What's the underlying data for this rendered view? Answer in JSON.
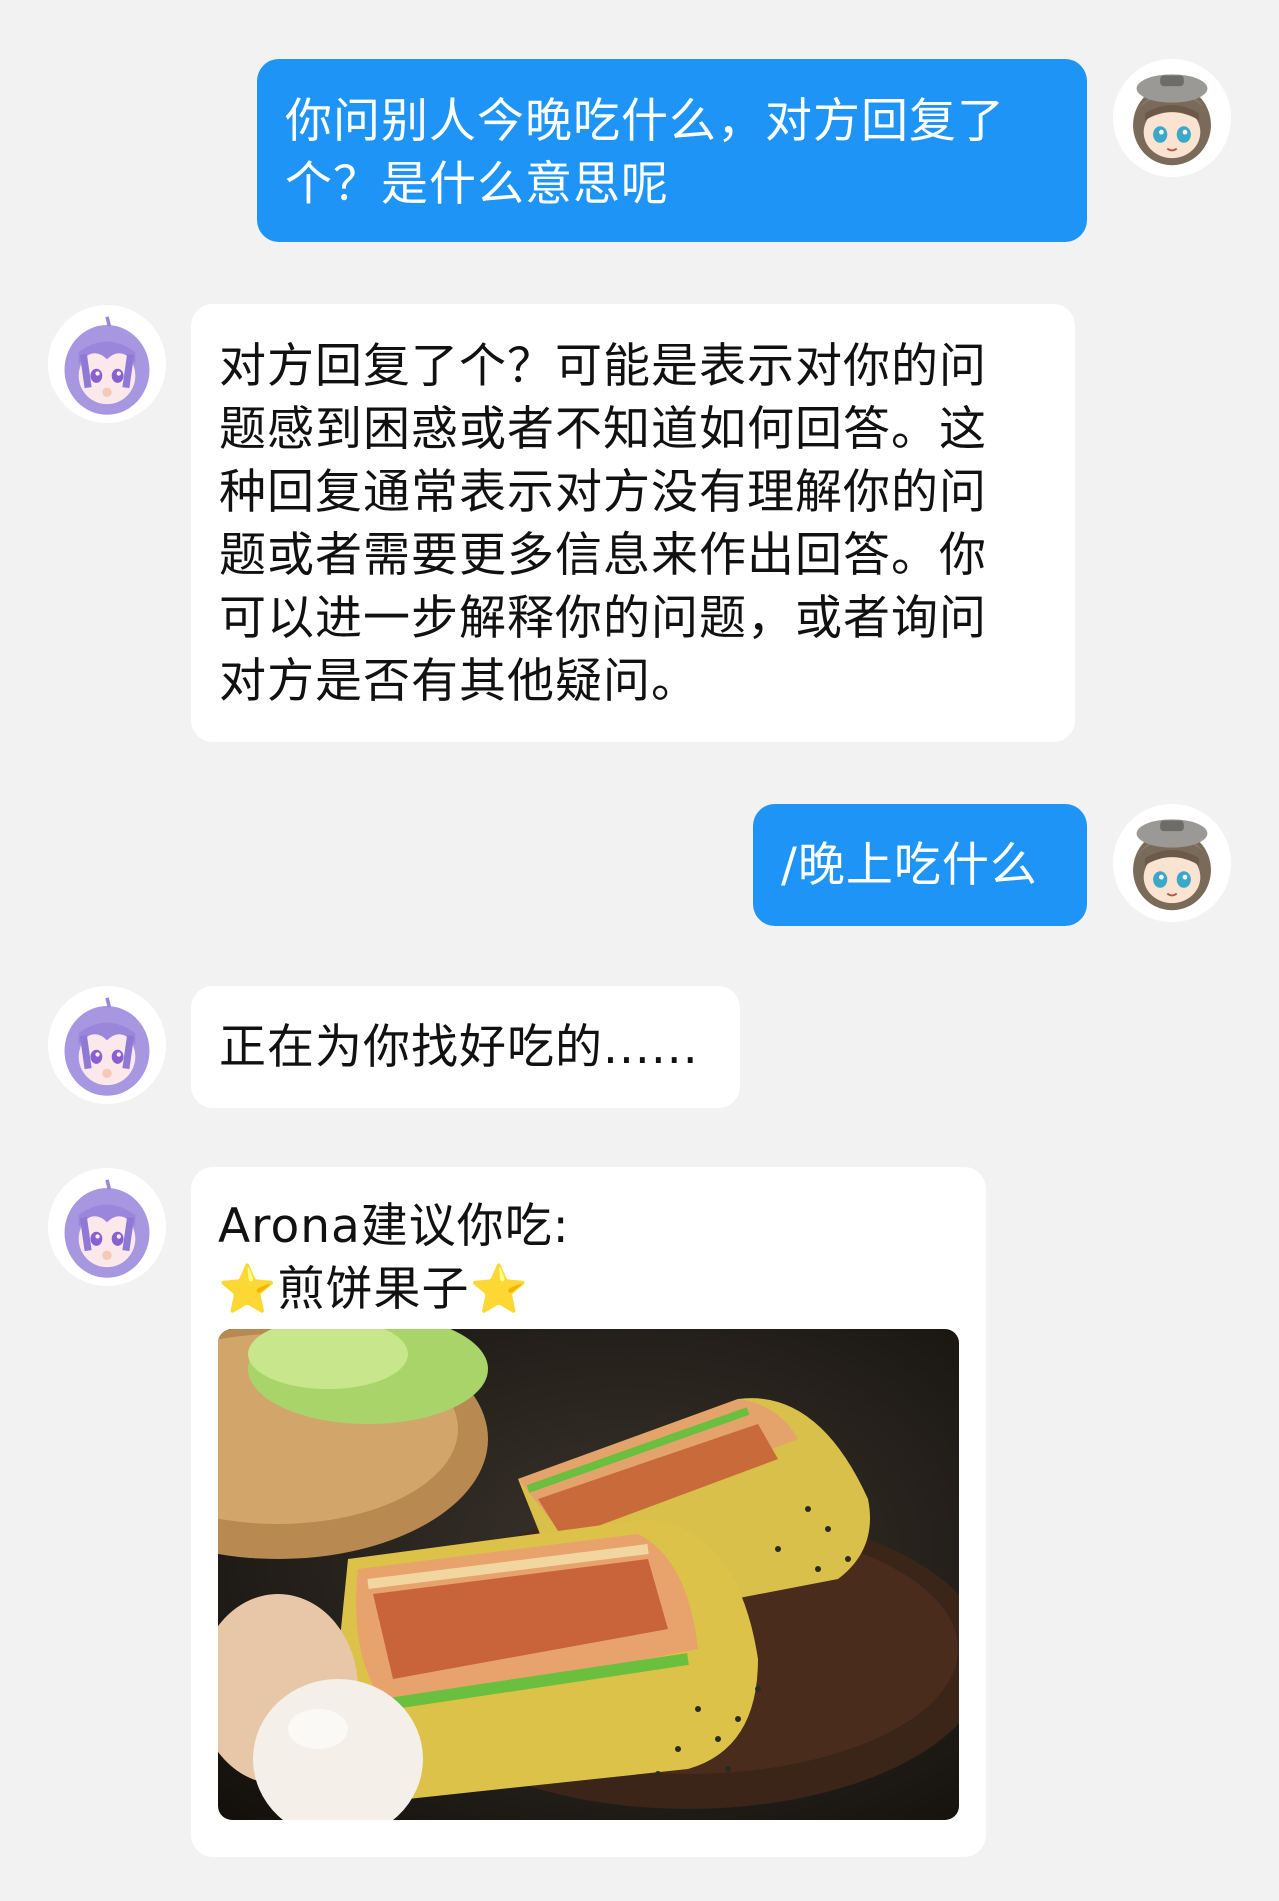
{
  "messages": [
    {
      "sender": "user",
      "lines": [
        "你问别人今晚吃什么，对方回复了",
        "个？是什么意思呢"
      ]
    },
    {
      "sender": "bot",
      "lines": [
        "对方回复了个？可能是表示对你的问",
        "题感到困惑或者不知道如何回答。这",
        "种回复通常表示对方没有理解你的问",
        "题或者需要更多信息来作出回答。你",
        "可以进一步解释你的问题，或者询问",
        "对方是否有其他疑问。"
      ]
    },
    {
      "sender": "user",
      "lines": [
        "/晚上吃什么"
      ]
    },
    {
      "sender": "bot",
      "lines": [
        "正在为你找好吃的......"
      ]
    },
    {
      "sender": "bot",
      "lines": [
        "Arona建议你吃:"
      ],
      "star_left": "⭐",
      "dish": "煎饼果子",
      "star_right": "⭐",
      "image": "jianbing-guozi-photo"
    }
  ],
  "colors": {
    "background": "#f2f2f2",
    "user_bubble": "#1e94f6",
    "bot_bubble": "#ffffff"
  }
}
